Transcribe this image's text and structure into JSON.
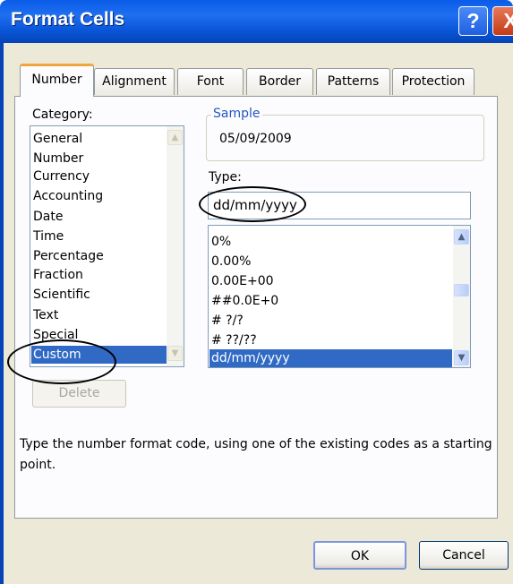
{
  "window": {
    "title": "Format Cells",
    "help_glyph": "?",
    "close_glyph": "X"
  },
  "tabs": [
    {
      "label": "Number",
      "active": true
    },
    {
      "label": "Alignment",
      "active": false
    },
    {
      "label": "Font",
      "active": false
    },
    {
      "label": "Border",
      "active": false
    },
    {
      "label": "Patterns",
      "active": false
    },
    {
      "label": "Protection",
      "active": false
    }
  ],
  "category": {
    "label": "Category:",
    "items": [
      "General",
      "Number",
      "Currency",
      "Accounting",
      "Date",
      "Time",
      "Percentage",
      "Fraction",
      "Scientific",
      "Text",
      "Special",
      "Custom"
    ],
    "selected": "Custom"
  },
  "sample": {
    "label": "Sample",
    "value": "05/09/2009"
  },
  "type": {
    "label": "Type:",
    "value": "dd/mm/yyyy",
    "items": [
      "0%",
      "0.00%",
      "0.00E+00",
      "##0.0E+0",
      "# ?/?",
      "# ??/??",
      "dd/mm/yyyy"
    ],
    "selected": "dd/mm/yyyy"
  },
  "buttons": {
    "delete": "Delete",
    "ok": "OK",
    "cancel": "Cancel"
  },
  "description": {
    "line1": "Type the number format code, using one of the existing codes as a starting",
    "line2": "point."
  },
  "scrollbar_glyphs": {
    "up": "▲",
    "down": "▼"
  },
  "colors": {
    "title_bar": "#0a5ce8",
    "selection": "#316ac5",
    "dialog_bg": "#ece9d8",
    "active_tab_accent": "#f2a53a"
  }
}
